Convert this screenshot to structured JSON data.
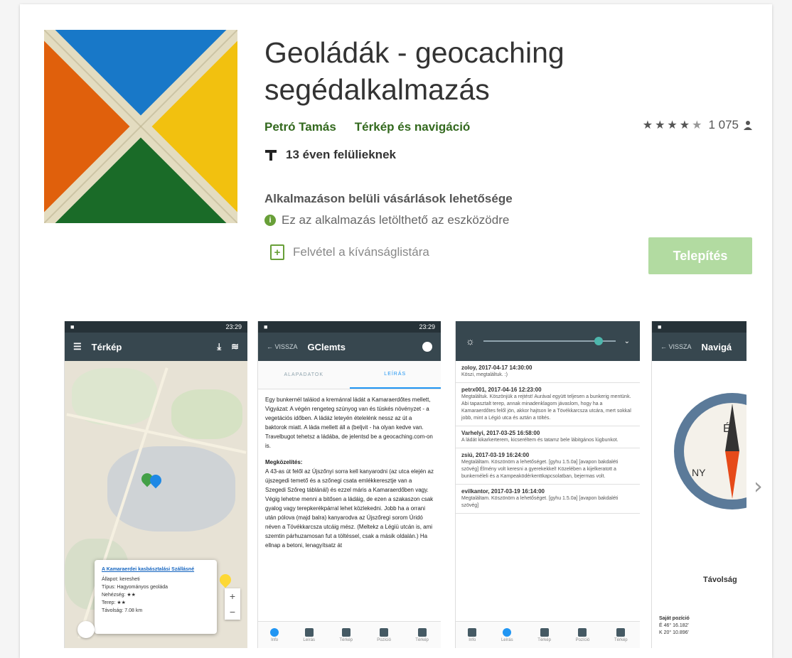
{
  "app": {
    "title": "Geoládák - geocaching segédalkalmazás",
    "developer": "Petró Tamás",
    "category": "Térkép és navigáció",
    "rating_count": "1 075",
    "rating_stars": 4.5,
    "age_rating": "13 éven felülieknek",
    "in_app_purchases": "Alkalmazáson belüli vásárlások lehetősége",
    "compatibility": "Ez az alkalmazás letölthető az eszközödre",
    "wishlist_label": "Felvétel a kívánságlistára",
    "install_label": "Telepítés"
  },
  "icon_colors": {
    "top": "#1878c8",
    "left": "#e0600c",
    "right": "#f2c10f",
    "bottom": "#1a6b28",
    "cross": "#e3dcc0"
  },
  "screenshots": {
    "map": {
      "status_time": "23:29",
      "title": "Térkép",
      "popup": {
        "title": "A Kamaraerdei kasbásztalási Szállásné",
        "lines": [
          "Állapot: keresheti",
          "Típus: Hagyományos geoláda",
          "Nehézség: ★★",
          "Terep: ★★",
          "Távolság: 7.08 km"
        ]
      }
    },
    "gcinfo": {
      "status_time": "23:29",
      "back": "VISSZA",
      "title": "GClemts",
      "tabs": [
        "ALAPADATOK",
        "LEÍRÁS"
      ],
      "body": "Egy bunkernél taláiod a kremánral ládát a Kamaraerdőtes mellett, Vigyázat: A végén rengeteg szúnyog van és tüskés növényzet - a vegetációs időben. A ládáz leteyén ételelénk nessz az út a baktorok miatt. A láda mellett áll a (beljvit - ha olyan kedve van. Travelbugot tehetsz a ládába, de jelentsd be a geocaching.com-on is.",
      "heading": "Megközelítés:",
      "body2": "A 43-as út felől az Újszőnyi sorra kell kanyarodni (az utca elején az újszegedi temető és a szőnegi csata emlékkeresztje van a Szegedi Szőreg táblánál) és ezzel máris a Kamaraerdőben vagy. Végig lehetne menni a bitősen a ládáig, de ezen a szakaszon csak gyalog vagy terepkerékpárral lehet közlekedni. Jobb ha a orrani után pólova (majd balra) kanyarodva az Újszőregi sorom Úridó néven a Tövékkarcsza utcáig mész. (Meltekz a Légiü utcán is, ami szemtin párhuzamosan fut a töltéssel, csak a másik oldalán.) Ha ellnap a betoni, lenagyítsatz át"
    },
    "logs": {
      "entries": [
        {
          "head": "zoloy, 2017-04-17 14:30:00",
          "text": "Köszi, megtaláltuk. :)"
        },
        {
          "head": "petrx001, 2017-04-16 12:23:00",
          "text": "Megtaláltuk. Köszönjük a rejtést! Aurával együtt teljesen a bunkerig mentünk. Abi tapasztalt terep, annak minadenklagom jávaslom, hogy ha a Kamaraerdőtes felől jön, akkor hajtson le a Tövékkarcsza utcára, mert sokkal jobb, mint a Légió utca és aztán a töltés."
        },
        {
          "head": "Varhelyi, 2017-03-25 16:58:00",
          "text": "A ládát kikarkerterem, kicseréltem és tatamz bele lábitgános lúgbunkot."
        },
        {
          "head": "zsiú, 2017-03-19 16:24:00",
          "text": "Megtaláltam. Köszönöm a lehetőséget. [gyhu 1.5.0a] [avapon bakdaléti szövég] Élmény volt keresni a gyerekekkel! Közelében a kijelkeratott a bunkernéleli és a Kampeaködérkenttkapcsolatban, bejermas volt."
        },
        {
          "head": "evilkantor, 2017-03-19 16:14:00",
          "text": "Megtaláltam. Köszönöm a lehetőséget. [gyhu 1.5.0a] [avapon bakdaléti szövég]"
        }
      ]
    },
    "navigation": {
      "back": "VISSZA",
      "title": "Navigá",
      "distance_label": "Távolság",
      "own_position_label": "Saját pozíció",
      "lat": "É 46° 16.182'",
      "lon": "K 20° 10.896'",
      "compass_e": "É",
      "compass_ny": "NY"
    },
    "nav_items": [
      "Info",
      "Leírás",
      "Térkép",
      "Pozíció",
      "Térkép"
    ]
  }
}
